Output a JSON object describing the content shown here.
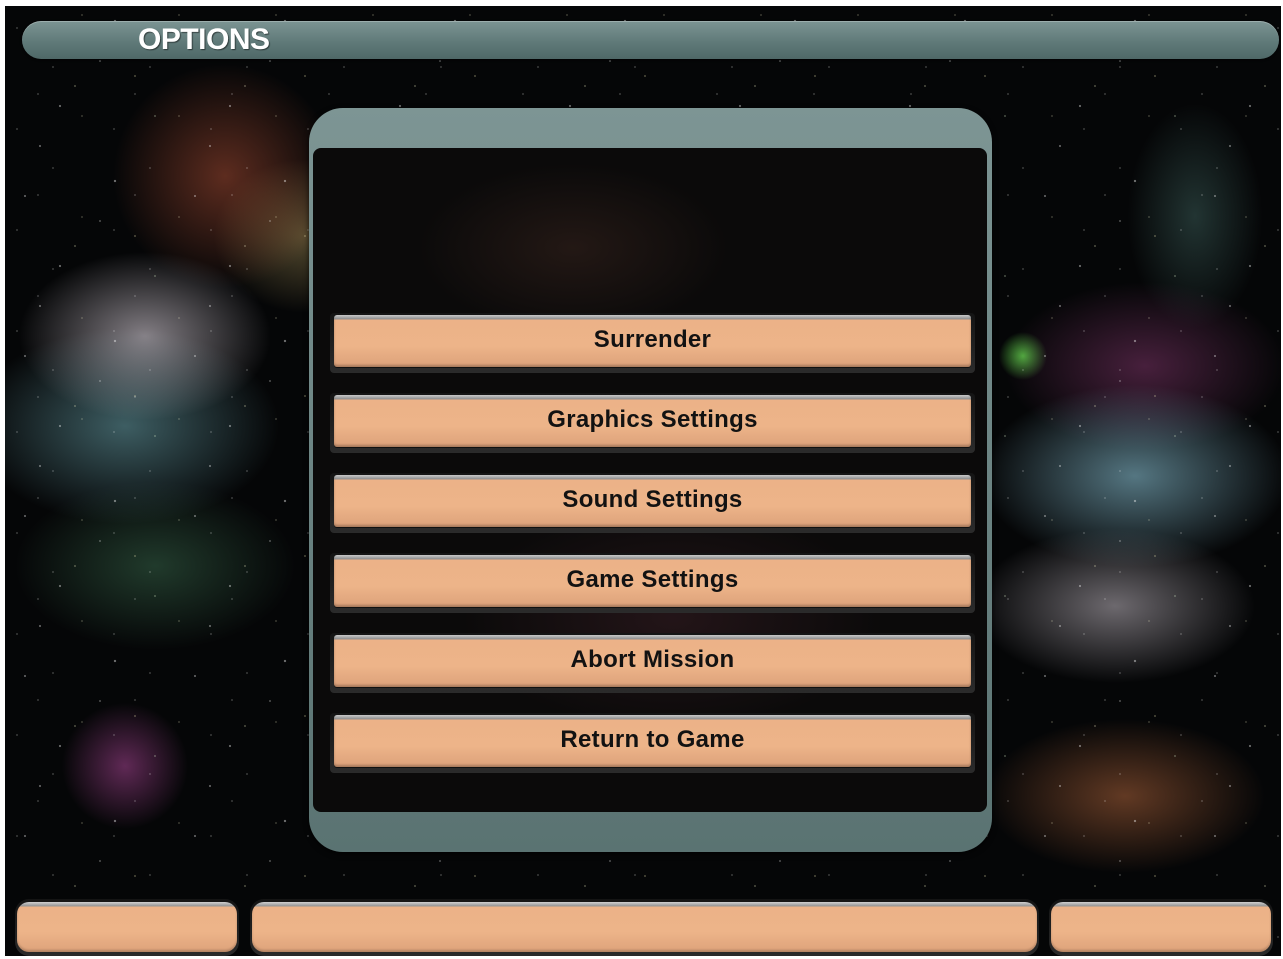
{
  "header": {
    "title": "OPTIONS"
  },
  "menu": {
    "items": [
      {
        "label": "Surrender"
      },
      {
        "label": "Graphics Settings"
      },
      {
        "label": "Sound Settings"
      },
      {
        "label": "Game Settings"
      },
      {
        "label": "Abort Mission"
      },
      {
        "label": "Return to Game"
      }
    ]
  },
  "colors": {
    "frame": "#607a79",
    "button_face": "#edb489",
    "button_text": "#121212",
    "background": "#050607"
  }
}
